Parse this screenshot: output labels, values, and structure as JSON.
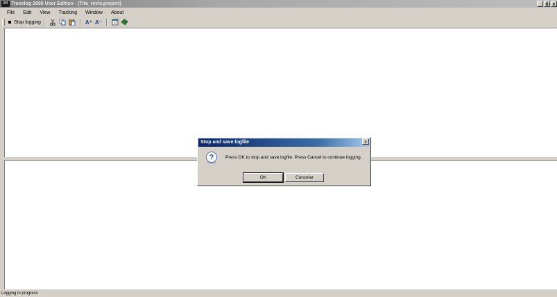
{
  "window": {
    "app_icon_text": "trl",
    "title": "Translog 2006 User Edition - [Tita_revis.project]",
    "controls": [
      "_",
      "ő",
      "x"
    ]
  },
  "menu": [
    "File",
    "Edit",
    "View",
    "Tracking",
    "Window",
    "About"
  ],
  "toolbar": {
    "stop_logging_label": "Stop logging",
    "icons": [
      "cut-icon",
      "copy-icon",
      "paste-icon",
      "font-increase-icon",
      "font-decrease-icon",
      "calendar-icon",
      "book-icon"
    ],
    "font_increase_glyph": "A⁺",
    "font_decrease_glyph": "A⁻"
  },
  "dialog": {
    "title": "Stop and save logfile",
    "close_glyph": "x",
    "message": "Press OK to stop and save logfile. Press Cancel to continue logging.",
    "ok_label": "OK",
    "cancel_label": "Cancelar"
  },
  "status": {
    "text": "Logging in progress"
  }
}
